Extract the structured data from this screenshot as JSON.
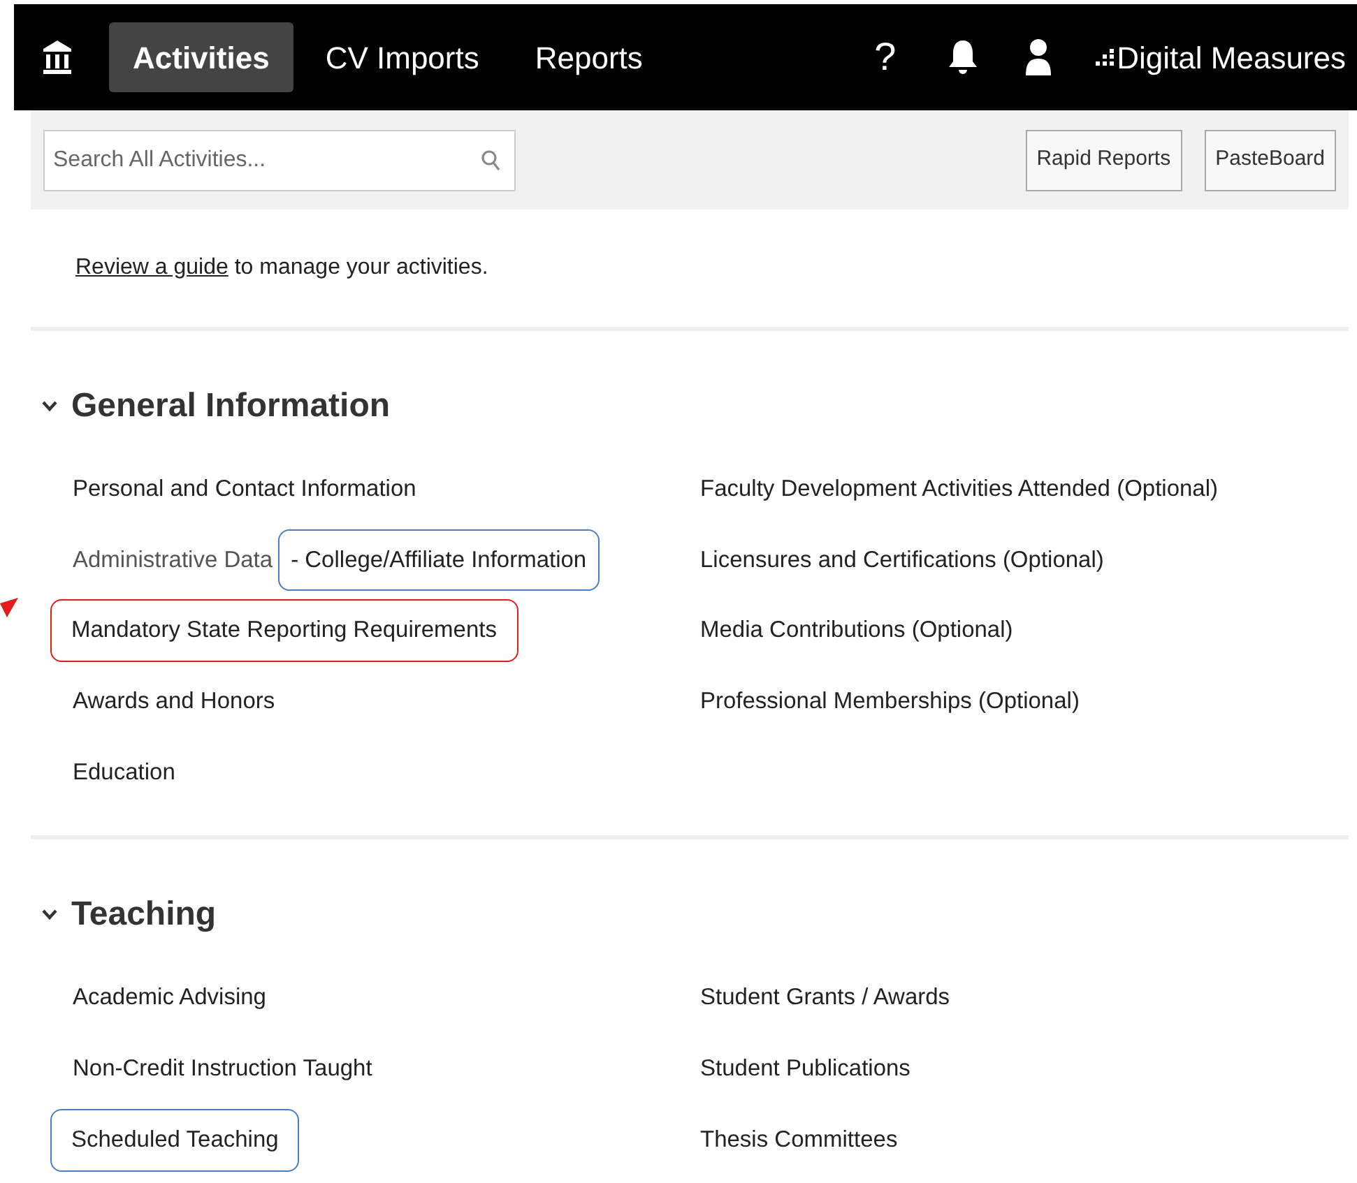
{
  "nav": {
    "tabs": [
      {
        "label": "Activities",
        "selected": true
      },
      {
        "label": "CV Imports",
        "selected": false
      },
      {
        "label": "Reports",
        "selected": false
      }
    ],
    "help": "?",
    "brand": "Digital Measures"
  },
  "toolbar": {
    "search": {
      "placeholder": "Search All Activities..."
    },
    "buttons": [
      "Rapid Reports",
      "PasteBoard"
    ]
  },
  "intro": {
    "link": "Review a guide",
    "text": " to manage your activities."
  },
  "sections": [
    {
      "title": "General Information",
      "expanded": true,
      "columns": [
        [
          {
            "label": "Personal and Contact Information"
          },
          {
            "label": "Administrative Data",
            "suffix": "- College/Affiliate Information",
            "color": "#4a7cc4"
          },
          {
            "label": "Mandatory State Reporting Requirements",
            "color": "#e31b1b"
          },
          {
            "label": "Awards and Honors"
          },
          {
            "label": "Education"
          }
        ],
        [
          {
            "label": "Faculty Development Activities Attended (Optional)"
          },
          {
            "label": "Licensures and Certifications (Optional)"
          },
          {
            "label": "Media Contributions (Optional)"
          },
          {
            "label": "Professional Memberships (Optional)"
          }
        ]
      ]
    },
    {
      "title": "Teaching",
      "expanded": true,
      "columns": [
        [
          {
            "label": "Academic Advising"
          },
          {
            "label": "Non-Credit Instruction Taught"
          },
          {
            "label": "Scheduled Teaching",
            "color": "#4a7cc4"
          }
        ],
        [
          {
            "label": "Student Grants / Awards"
          },
          {
            "label": "Student Publications"
          },
          {
            "label": "Thesis Committees"
          }
        ]
      ]
    }
  ]
}
